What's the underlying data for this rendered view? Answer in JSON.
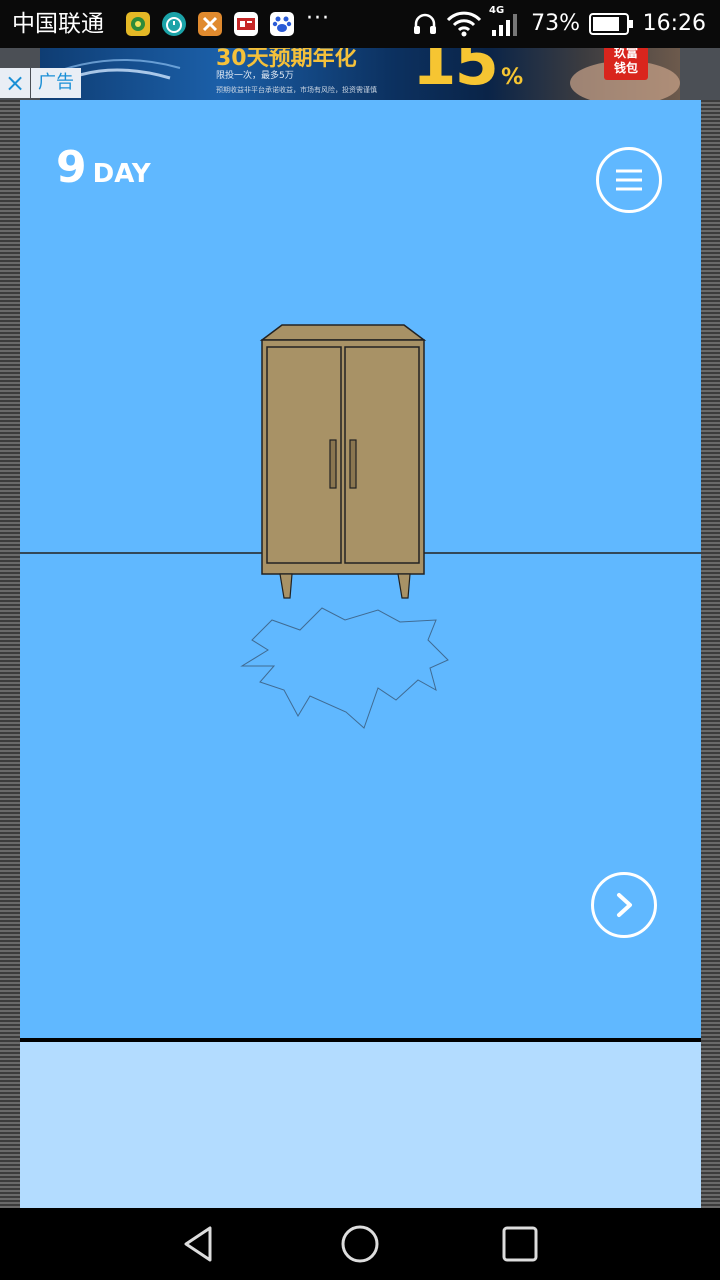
{
  "status_bar": {
    "carrier": "中国联通",
    "more_indicator": "···",
    "network": "4G",
    "battery": "73%",
    "time": "16:26",
    "icons": [
      "app-notification-icon",
      "timer-icon",
      "app-notification-icon",
      "news-icon",
      "baidu-icon",
      "headphones-icon",
      "wifi-icon",
      "signal-icon",
      "battery-icon"
    ]
  },
  "ad": {
    "close_label": "×",
    "ad_label": "广告",
    "headline": "30天预期年化",
    "rate": "15",
    "rate_unit": "%",
    "subline": "限投一次，最多5万",
    "fineprint": "预期收益非平台承诺收益，市场有风险，投资需谨慎",
    "brand": "玖富\n钱包"
  },
  "game": {
    "day_number": "9",
    "day_label": "DAY",
    "menu_icon": "hamburger-menu-icon",
    "next_icon": "chevron-right-icon",
    "colors": {
      "sky": "#60b8ff",
      "panel": "#b3dcff",
      "wardrobe": "#a89266",
      "outline": "#222222"
    }
  },
  "nav_bar": {
    "back_icon": "triangle-back-icon",
    "home_icon": "circle-home-icon",
    "recent_icon": "square-recent-icon"
  }
}
